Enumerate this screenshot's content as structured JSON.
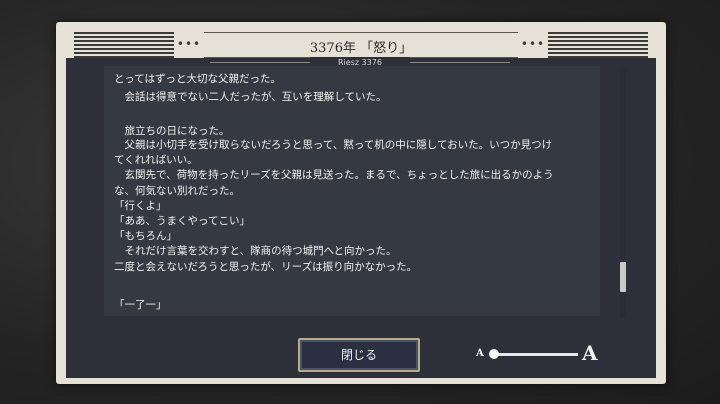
{
  "dialog": {
    "title": "3376年 「怒り」",
    "subtitle": "Riesz 3376",
    "header_dots_left": "•••",
    "header_dots_right": "•••"
  },
  "story_lines": [
    "とってはずっと大切な父親だった。",
    "　会話は得意でない二人だったが、互いを理解していた。",
    "",
    "　旅立ちの日になった。",
    "　父親は小切手を受け取らないだろうと思って、黙って机の中に隠しておいた。いつか見つけ",
    "てくれればいい。",
    "　玄関先で、荷物を持ったリーズを父親は見送った。まるで、ちょっとした旅に出るかのよう",
    "な、何気ない別れだった。",
    "「行くよ」",
    "「ああ、うまくやってこい」",
    "「もちろん」",
    "　それだけ言葉を交わすと、隊商の待つ城門へと向かった。",
    "二度と会えないだろうと思ったが、リーズは振り向かなかった。",
    "",
    "「一了一」"
  ],
  "controls": {
    "close_label": "閉じる",
    "font_small_label": "A",
    "font_large_label": "A",
    "font_size_level": 0.0
  },
  "scroll": {
    "position": 0.88
  }
}
